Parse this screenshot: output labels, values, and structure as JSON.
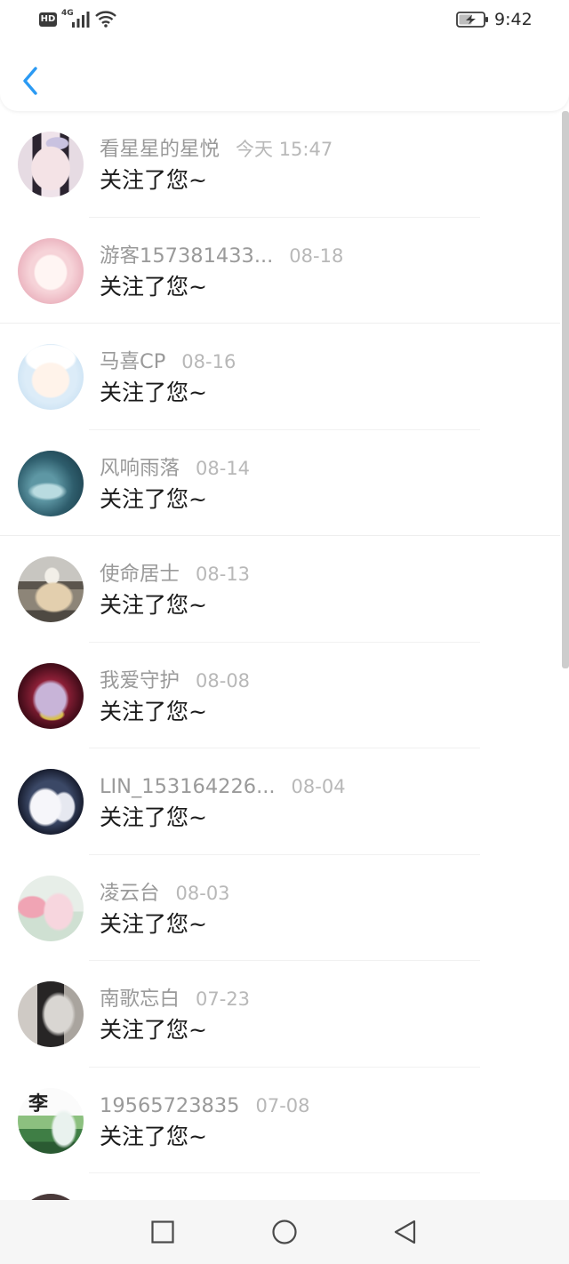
{
  "status_bar": {
    "hd": "HD",
    "network": "4G",
    "time": "9:42",
    "icons": [
      "signal-icon",
      "wifi-icon",
      "battery-charging-icon"
    ]
  },
  "header": {
    "back_icon": "chevron-left-icon"
  },
  "colors": {
    "accent": "#2b9af3",
    "name_text": "#9a9a9a",
    "time_text": "#b8b8b8",
    "message_text": "#1a1a1a"
  },
  "notifications": [
    {
      "name": "看星星的星悦",
      "time": "今天 15:47",
      "message": "关注了您~"
    },
    {
      "name": "游客157381433...",
      "time": "08-18",
      "message": "关注了您~"
    },
    {
      "name": "马喜CP",
      "time": "08-16",
      "message": "关注了您~"
    },
    {
      "name": "风响雨落",
      "time": "08-14",
      "message": "关注了您~"
    },
    {
      "name": "使命居士",
      "time": "08-13",
      "message": "关注了您~"
    },
    {
      "name": "我爱守护",
      "time": "08-08",
      "message": "关注了您~"
    },
    {
      "name": "LIN_153164226...",
      "time": "08-04",
      "message": "关注了您~"
    },
    {
      "name": "凌云台",
      "time": "08-03",
      "message": "关注了您~"
    },
    {
      "name": "南歌忘白",
      "time": "07-23",
      "message": "关注了您~"
    },
    {
      "name": "19565723835",
      "time": "07-08",
      "message": "关注了您~",
      "avatar_text": "李"
    }
  ],
  "nav_bar": {
    "icons": [
      "recent-apps-square-icon",
      "home-circle-icon",
      "back-triangle-icon"
    ]
  }
}
